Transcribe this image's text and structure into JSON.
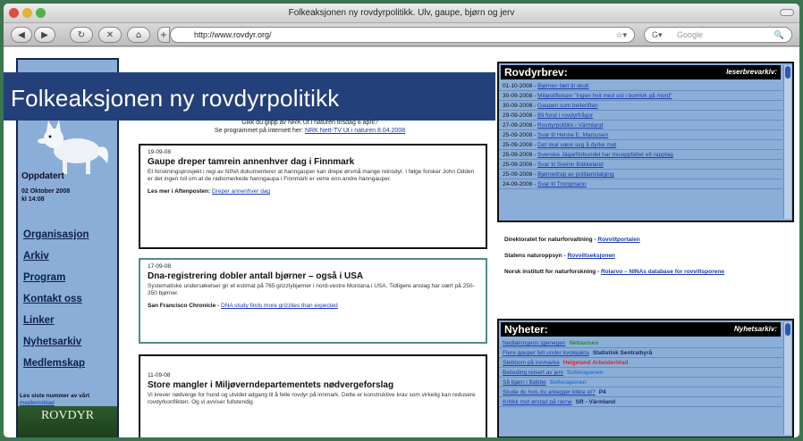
{
  "window": {
    "title": "Folkeaksjonen ny rovdyrpolitikk. Ulv, gaupe, bjørn og jerv"
  },
  "toolbar": {
    "url": "http://www.rovdyr.org/",
    "search_placeholder": "Google"
  },
  "site": {
    "banner": "Folkeaksjonen ny rovdyrpolitikk"
  },
  "sidebar": {
    "updated_label": "Oppdatert",
    "updated_date": "02 Oktober 2008",
    "updated_time": "kl 14:08",
    "nav": [
      "Organisasjon",
      "Arkiv",
      "Program",
      "Kontakt oss",
      "Linker",
      "Nyhetsarkiv",
      "Medlemskap"
    ],
    "last_issue_text": "Les siste nummer av vårt",
    "last_issue_link": "medlemsblad",
    "magazine": "ROVDYR"
  },
  "intro": {
    "line1": "Gikk du glipp av NRK Ut i naturen tirsdag 8 april?",
    "line2": "Se programmet på internett her:",
    "link": "NRK Nett-TV Ut i naturen 8.04.2008"
  },
  "articles": [
    {
      "date": "19-09-08",
      "headline": "Gaupe dreper tamrein annenhver dag i Finnmark",
      "body": "Et forskningsprosjekt i regi av NINA dokumenterer at hanngauper kan drepe ørsmå mange reinsdyr. I følge forsker John Odden er det ingen tvil om at de radiomerkede hanngaupa i Finnmark er verre enn andre hanngauper.",
      "source_label": "Les mer i Aftenposten:",
      "source_link": "Dreper annenhver dag"
    },
    {
      "date": "17-09-08",
      "headline": "Dna-registrering dobler antall bjørner – også i USA",
      "body": "Systematiske undersøkelser gir et estimat på 765 grizzlybjørner i nord-vestre Montana i USA. Tidligere anslag har vært på 250- 350 bjørner.",
      "source_label": "San Francisco Chronicle -",
      "source_link": "DNA study finds more grizzlies than expected"
    },
    {
      "date": "11-09-08",
      "headline": "Store mangler i Miljøverndepartementets nødvergeforslag",
      "body": "Vi krever nødverge for hund og utvidet adgang til å felle rovdyr på innmark. Dette er konstruktive krav som virkelig kan redusere rovdyrkonflikten. Og vi avviser fullstendig"
    }
  ],
  "rovdyrbrev": {
    "title": "Rovdyrbrev:",
    "archive": "leserbrevarkiv:",
    "items": [
      {
        "date": "01-10-2008",
        "text": "Bjørnen fælt til skutt"
      },
      {
        "date": "30-09-2008",
        "text": "Miljøstiftelsen \"Ingen hvit med ost i bomlok på mord\""
      },
      {
        "date": "30-09-2008",
        "text": "Gaupen som beiteriften"
      },
      {
        "date": "29-09-2008",
        "text": "Bli forut i rovdyrfrågor"
      },
      {
        "date": "27-09-2008",
        "text": "Rovdyrpolitikk i Värmland"
      },
      {
        "date": "25-09-2008",
        "text": "Svar til Henne E. Marcusen"
      },
      {
        "date": "25-09-2008",
        "text": "Det skal være seg å dyrke mat"
      },
      {
        "date": "25-09-2008",
        "text": "Svenske Jägarförbundet har misoppfattet ett rapptag"
      },
      {
        "date": "25-09-2008",
        "text": "Svar til Sveinn Bäkkeland"
      },
      {
        "date": "25-09-2008",
        "text": "Bjørnedrap av politianstalging"
      },
      {
        "date": "24-09-2008",
        "text": "Svar til Trongmann"
      }
    ]
  },
  "links": [
    {
      "label": "Direktoratet for naturforvaltning -",
      "link": "Rovviltportalen"
    },
    {
      "label": "Statens naturoppsyn -",
      "link": "Rovviltseksjonen"
    },
    {
      "label": "Norsk institutt for naturforskning -",
      "link": "Rolarvo – NINAs database for rovviltsporene"
    }
  ],
  "nyheter": {
    "title": "Nyheter:",
    "archive": "Nyhetsarkiv:",
    "items": [
      {
        "text": "Nedlæringens igjenegen",
        "tag": "Nettavisen",
        "tag_color": "#2e8a2e"
      },
      {
        "text": "Flere gauper felt under kvotejakta",
        "tag": "Statistisk Sentralbyrå",
        "tag_color": "#1a2a6a"
      },
      {
        "text": "Stebbom på innmarka",
        "tag": "Helgeland Arbeiderblad",
        "tag_color": "#e02828"
      },
      {
        "text": "Beiteding reisert av jerv",
        "tag": "Sollerapenen",
        "tag_color": "#2a78d8"
      },
      {
        "text": "Så bjørn i Bøbbe",
        "tag": "Sollerapenen",
        "tag_color": "#2a78d8"
      },
      {
        "text": "Skulle du hvis du anlegger kikke et?",
        "tag": "P4",
        "tag_color": "#1a2a6a"
      },
      {
        "text": "Kritikk mot ørstad på ravne",
        "tag": "SR - Värmland",
        "tag_color": "#1a2a6a"
      }
    ]
  }
}
